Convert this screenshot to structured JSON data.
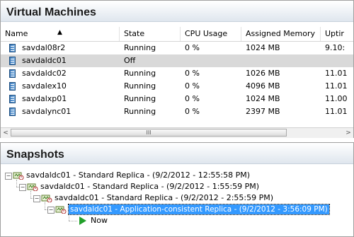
{
  "vm_panel": {
    "title": "Virtual Machines",
    "columns": [
      "Name",
      "State",
      "CPU Usage",
      "Assigned Memory",
      "Uptir"
    ],
    "rows": [
      {
        "name": "savdal08r2",
        "state": "Running",
        "cpu": "0 %",
        "memory": "1024 MB",
        "uptime": "9.10:"
      },
      {
        "name": "savdaldc01",
        "state": "Off",
        "cpu": "",
        "memory": "",
        "uptime": ""
      },
      {
        "name": "savdaldc02",
        "state": "Running",
        "cpu": "0 %",
        "memory": "1026 MB",
        "uptime": "11.01"
      },
      {
        "name": "savdalex10",
        "state": "Running",
        "cpu": "0 %",
        "memory": "4096 MB",
        "uptime": "11.01"
      },
      {
        "name": "savdalxp01",
        "state": "Running",
        "cpu": "0 %",
        "memory": "1024 MB",
        "uptime": "11.00"
      },
      {
        "name": "savdalync01",
        "state": "Running",
        "cpu": "0 %",
        "memory": "2397 MB",
        "uptime": "11.01"
      }
    ],
    "selected_row": 1,
    "scroll_left": "<",
    "scroll_right": ">",
    "scroll_grip": "III"
  },
  "snap_panel": {
    "title": "Snapshots",
    "nodes": [
      {
        "label": "savdaldc01 - Standard Replica - (9/2/2012 - 12:55:58 PM)"
      },
      {
        "label": "savdaldc01 - Standard Replica - (9/2/2012 - 1:55:59 PM)"
      },
      {
        "label": "savdaldc01 - Standard Replica - (9/2/2012 - 2:55:59 PM)"
      },
      {
        "label": "savdaldc01 - Application-consistent Replica - (9/2/2012 - 3:56:09 PM)"
      },
      {
        "label": "Now"
      }
    ],
    "expander_glyph": "−",
    "colors": {
      "selection": "#3399ff",
      "now_icon": "#22a02a"
    }
  }
}
